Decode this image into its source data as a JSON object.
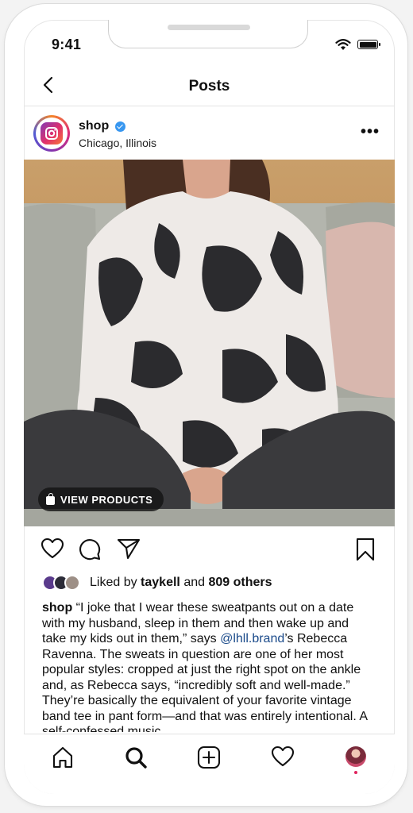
{
  "status_bar": {
    "time": "9:41"
  },
  "nav": {
    "title": "Posts"
  },
  "post": {
    "username": "shop",
    "location": "Chicago, Illinois",
    "view_products_label": "VIEW PRODUCTS",
    "likes": {
      "prefix": "Liked by",
      "liker": "taykell",
      "conjunction": "and",
      "others": "809 others"
    },
    "caption": {
      "author": "shop",
      "text_before_mention": "“I joke that I wear these sweatpants out on a date with my husband, sleep in them and then wake up and take my kids out in them,” says ",
      "mention": "@lhll.brand",
      "text_after_mention": "’s Rebecca Ravenna. The sweats in question are one of her most popular styles: cropped at just the right spot on the ankle and, as Rebecca says, “incredibly soft and well-made.” They’re basically the equivalent of your favorite vintage band tee in pant form—and that was entirely intentional. A self-confessed music"
    }
  },
  "icons": {
    "back": "chevron-left-icon",
    "more": "more-horizontal-icon",
    "like": "heart-icon",
    "comment": "comment-icon",
    "share": "send-icon",
    "save": "bookmark-icon",
    "home": "home-icon",
    "search": "search-icon",
    "add": "add-post-icon",
    "activity": "heart-icon",
    "profile": "profile-avatar"
  },
  "colors": {
    "mention": "#1a4a8a",
    "verified": "#3897f0",
    "notification_dot": "#e0245e"
  }
}
